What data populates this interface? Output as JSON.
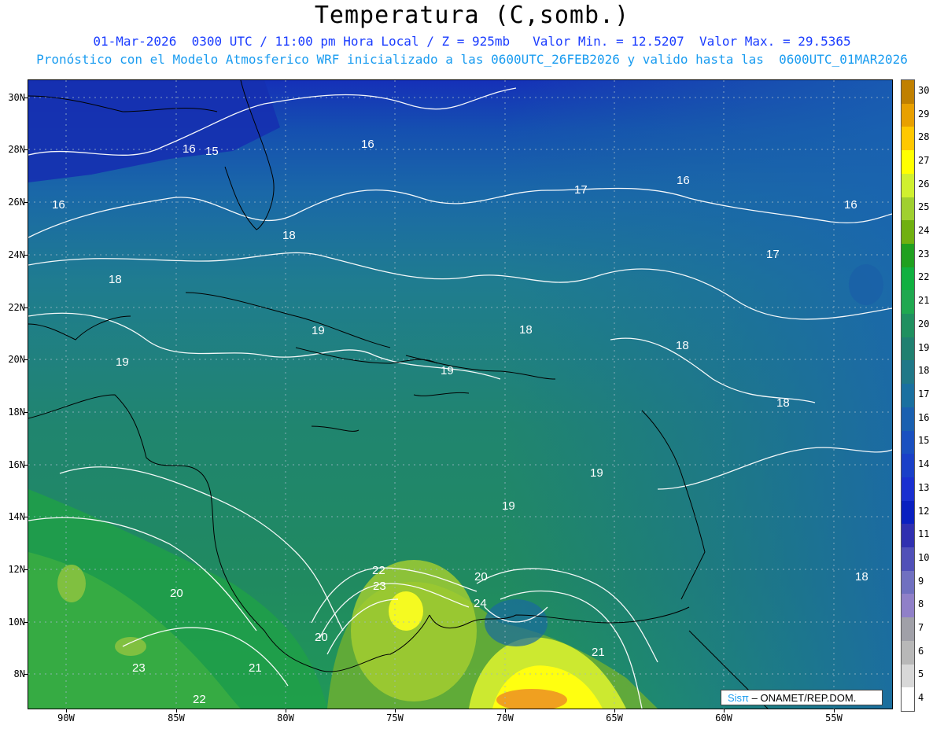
{
  "header": {
    "title": "Temperatura (C,somb.)",
    "line1": "01-Mar-2026  0300 UTC / 11:00 pm Hora Local / Z = 925mb   Valor Min. = 12.5207  Valor Max. = 29.5365",
    "line2": "Pronóstico con el Modelo Atmosferico WRF inicializado a las 0600UTC_26FEB2026 y valido hasta las  0600UTC_01MAR2026"
  },
  "axes": {
    "lat_labels": [
      "30N",
      "28N",
      "26N",
      "24N",
      "22N",
      "20N",
      "18N",
      "16N",
      "14N",
      "12N",
      "10N",
      "8N"
    ],
    "lon_labels": [
      "90W",
      "85W",
      "80W",
      "75W",
      "70W",
      "65W",
      "60W",
      "55W"
    ]
  },
  "colorbar": {
    "labels": [
      "30",
      "29",
      "28",
      "27",
      "26",
      "25",
      "24",
      "23",
      "22",
      "21",
      "20",
      "19",
      "18",
      "17",
      "16",
      "15",
      "14",
      "13",
      "12",
      "11",
      "10",
      "9",
      "8",
      "7",
      "6",
      "5",
      "4"
    ],
    "colors": [
      "#c08000",
      "#e8a000",
      "#ffc800",
      "#ffff00",
      "#d0f030",
      "#a0d030",
      "#70b010",
      "#20a020",
      "#10b040",
      "#20a850",
      "#209060",
      "#208070",
      "#207888",
      "#1a70a0",
      "#1a60b0",
      "#1a50c0",
      "#1a40c8",
      "#1a30d0",
      "#0a20c0",
      "#3030b0",
      "#5050b8",
      "#7070c0",
      "#9080c8",
      "#a0a0a8",
      "#b8b8b8",
      "#d8d8d8",
      "#ffffff"
    ]
  },
  "contour_labels": [
    "16",
    "15",
    "16",
    "16",
    "17",
    "16",
    "16",
    "17",
    "18",
    "18",
    "19",
    "19",
    "19",
    "18",
    "18",
    "18",
    "19",
    "19",
    "18",
    "22",
    "23",
    "20",
    "24",
    "20",
    "21",
    "20",
    "23",
    "21",
    "22"
  ],
  "credit": {
    "brand": "Sisπ",
    "text": "– ONAMET/REP.DOM."
  }
}
